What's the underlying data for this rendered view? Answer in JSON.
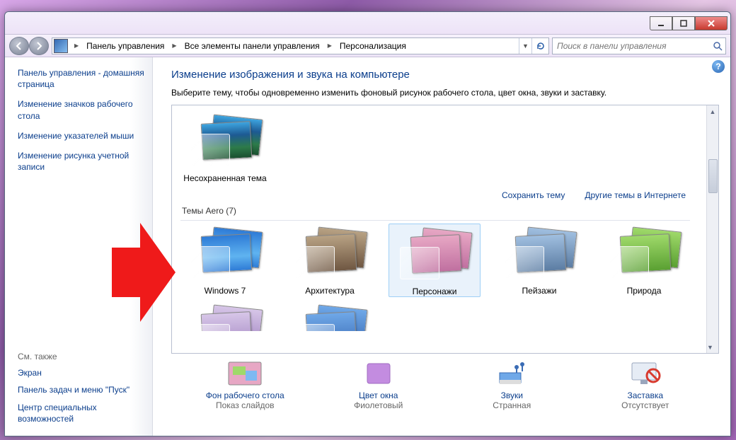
{
  "breadcrumb": {
    "seg1": "Панель управления",
    "seg2": "Все элементы панели управления",
    "seg3": "Персонализация"
  },
  "search": {
    "placeholder": "Поиск в панели управления"
  },
  "sidebar": {
    "home": "Панель управления - домашняя страница",
    "links": [
      "Изменение значков рабочего стола",
      "Изменение указателей мыши",
      "Изменение рисунка учетной записи"
    ],
    "see_also_title": "См. также",
    "see_also": [
      "Экран",
      "Панель задач и меню \"Пуск\"",
      "Центр специальных возможностей"
    ]
  },
  "main": {
    "heading": "Изменение изображения и звука на компьютере",
    "subtitle": "Выберите тему, чтобы одновременно изменить фоновый рисунок рабочего стола, цвет окна, звуки и заставку.",
    "unsaved_theme": "Несохраненная тема",
    "save_theme": "Сохранить тему",
    "more_themes": "Другие темы в Интернете",
    "aero_section": "Темы Aero (7)",
    "themes": [
      {
        "label": "Windows 7"
      },
      {
        "label": "Архитектура"
      },
      {
        "label": "Персонажи"
      },
      {
        "label": "Пейзажи"
      },
      {
        "label": "Природа"
      }
    ]
  },
  "bottom": {
    "items": [
      {
        "label": "Фон рабочего стола",
        "value": "Показ слайдов"
      },
      {
        "label": "Цвет окна",
        "value": "Фиолетовый"
      },
      {
        "label": "Звуки",
        "value": "Странная"
      },
      {
        "label": "Заставка",
        "value": "Отсутствует"
      }
    ]
  }
}
